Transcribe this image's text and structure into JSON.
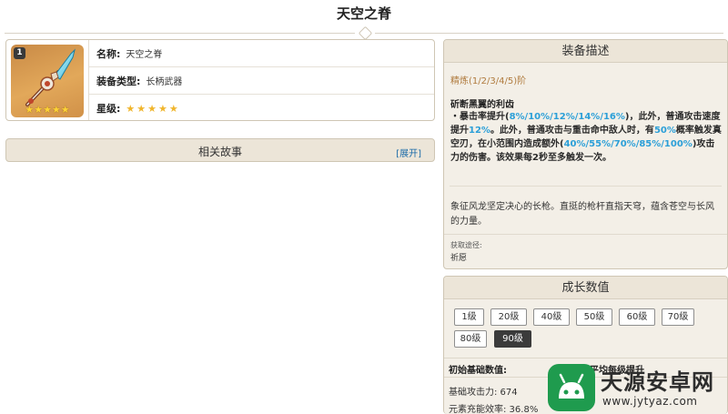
{
  "page": {
    "title": "天空之脊"
  },
  "info": {
    "rarity_badge": "1",
    "thumb_stars": "★★★★★",
    "name_key": "名称:",
    "name_value": "天空之脊",
    "type_key": "装备类型:",
    "type_value": "长柄武器",
    "star_key": "星级:",
    "star_value": "★★★★★"
  },
  "story": {
    "title": "相关故事",
    "expand_label": "[展开]"
  },
  "desc": {
    "title": "装备描述",
    "refine": "精炼(1/2/3/4/5)阶",
    "skill_name": "斫断黑翼的利齿",
    "t1": "・暴击率提升(",
    "h1": "8%/10%/12%/14%/16%",
    "t2": ")，此外，普通攻击速度提升",
    "h2": "12%",
    "t3": "。此外，普通攻击与重击命中敌人时，有",
    "h3": "50%",
    "t4": "概率触发真空刃，在小范围内造成额外(",
    "h4": "40%/55%/70%/85%/100%",
    "t5": ")攻击力的伤害。该效果每2秒至多触发一次。",
    "lore": "象征风龙坚定决心的长枪。直挺的枪杆直指天穹，蕴含苍空与长风的力量。",
    "source_label": "获取途径:",
    "source_value": "祈愿"
  },
  "growth": {
    "title": "成长数值",
    "levels": [
      "1级",
      "20级",
      "40级",
      "50级",
      "60级",
      "70级",
      "80级",
      "90级"
    ],
    "active_level": "90级",
    "base_title": "初始基础数值:",
    "refine_title": "平均每级提升",
    "stat_atk": "基础攻击力: 674",
    "stat_er": "元素充能效率: 36.8%"
  },
  "watermark": {
    "name": "天源安卓网",
    "url": "www.jytyaz.com"
  }
}
